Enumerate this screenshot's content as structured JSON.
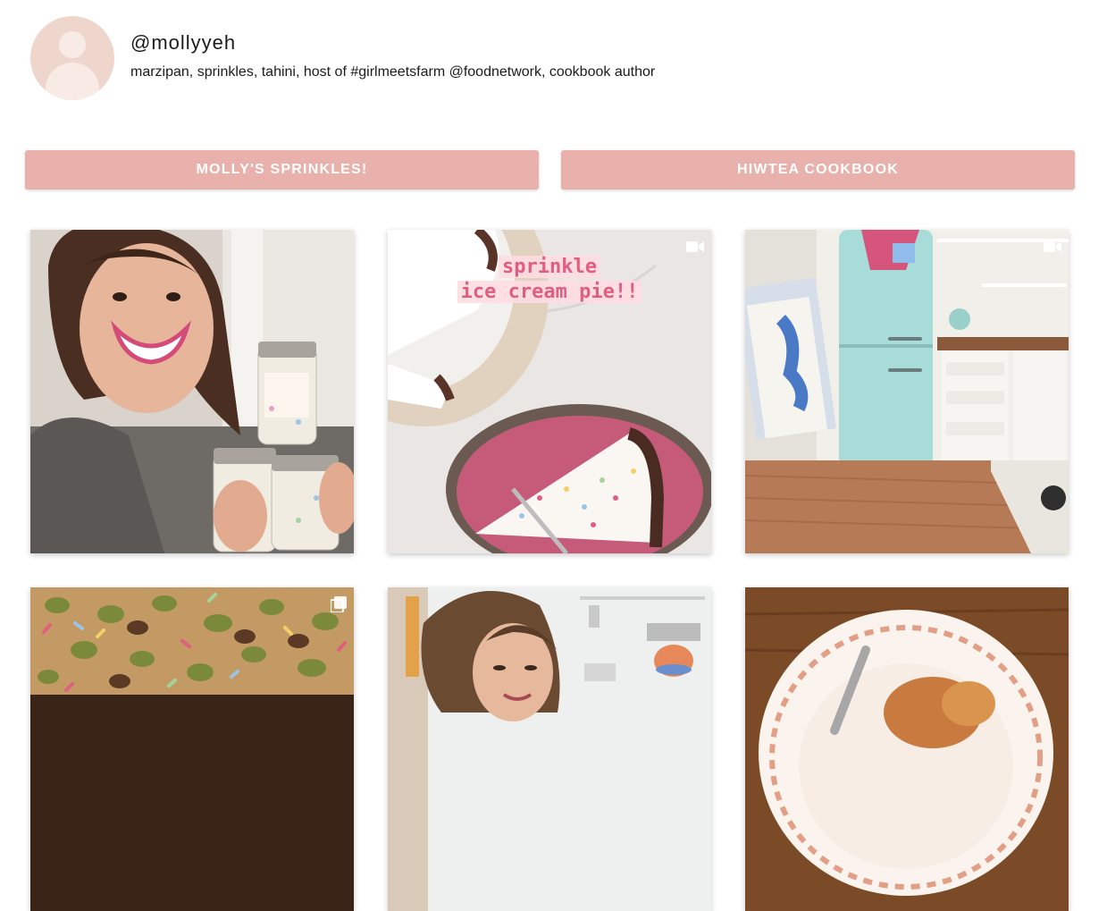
{
  "profile": {
    "handle": "@mollyyeh",
    "bio": "marzipan, sprinkles, tahini, host of #girlmeetsfarm @foodnetwork, cookbook author"
  },
  "links": [
    {
      "label": "MOLLY'S SPRINKLES!"
    },
    {
      "label": "HIWTEA COOKBOOK"
    }
  ],
  "posts": [
    {
      "type": "image"
    },
    {
      "type": "video",
      "overlay_line1": "sprinkle",
      "overlay_line2": "ice cream pie!!"
    },
    {
      "type": "video"
    },
    {
      "type": "carousel"
    },
    {
      "type": "image"
    },
    {
      "type": "image"
    }
  ],
  "colors": {
    "button_bg": "#e8b1ac",
    "avatar_bg": "#efd6cd",
    "overlay_text": "#e05f80"
  },
  "icons": {
    "video": "video-camera-icon",
    "carousel": "multiple-photos-icon"
  }
}
